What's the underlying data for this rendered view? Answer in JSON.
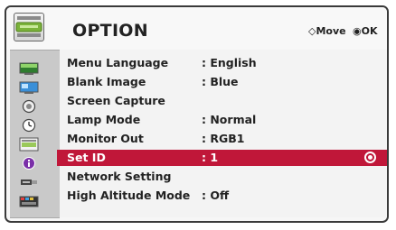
{
  "header": {
    "title": "OPTION",
    "move_hint": "◇Move",
    "ok_hint": "◉OK",
    "icon": "tools-icon"
  },
  "sidebar": {
    "items": [
      {
        "icon": "picture-icon"
      },
      {
        "icon": "screen-icon"
      },
      {
        "icon": "audio-icon"
      },
      {
        "icon": "time-icon"
      },
      {
        "icon": "option-icon",
        "active": true
      },
      {
        "icon": "info-icon"
      },
      {
        "icon": "input-icon"
      },
      {
        "icon": "media-icon"
      }
    ]
  },
  "menu": {
    "items": [
      {
        "label": "Menu Language",
        "value": ": English"
      },
      {
        "label": "Blank Image",
        "value": ": Blue"
      },
      {
        "label": "Screen Capture",
        "value": ""
      },
      {
        "label": "Lamp Mode",
        "value": ": Normal"
      },
      {
        "label": "Monitor Out",
        "value": ": RGB1"
      },
      {
        "label": "Set ID",
        "value": ": 1",
        "selected": true
      },
      {
        "label": "Network Setting",
        "value": ""
      },
      {
        "label": "High Altitude Mode",
        "value": ": Off"
      }
    ]
  },
  "colors": {
    "selected_row": "#c01739",
    "sidebar": "#c9c9c9"
  }
}
